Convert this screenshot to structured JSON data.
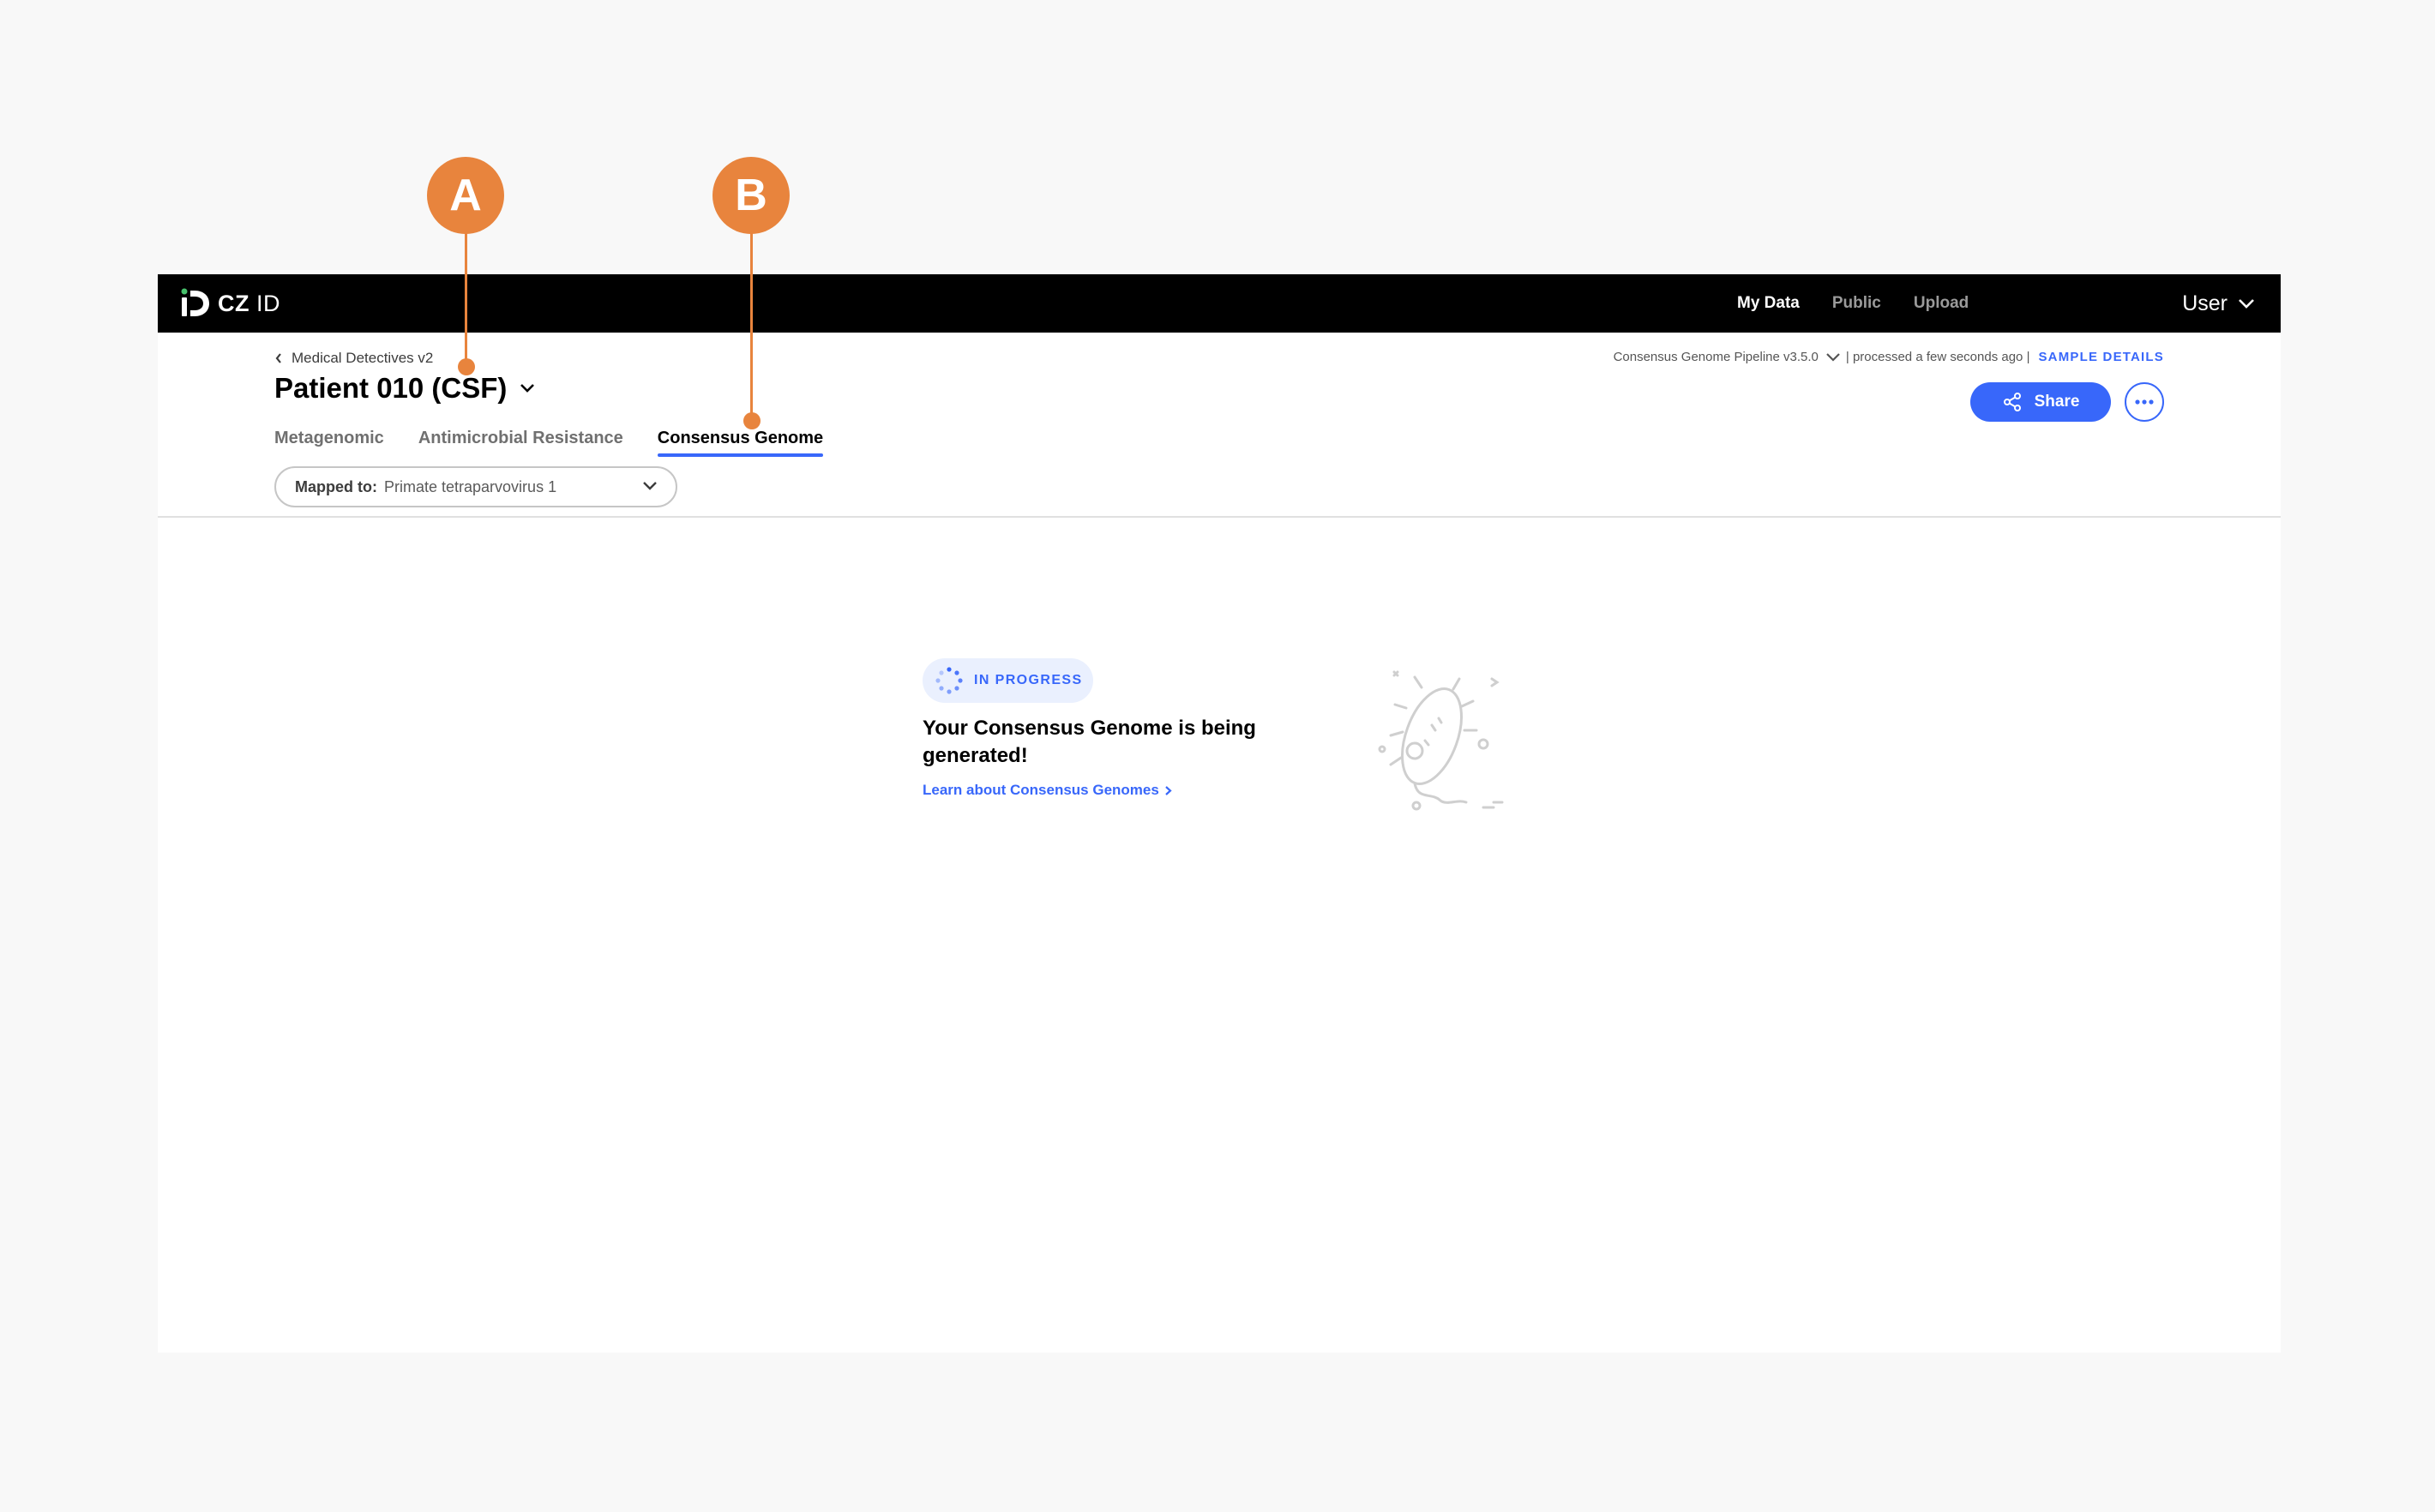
{
  "topbar": {
    "logo": {
      "mark": "iD",
      "text_bold": "CZ",
      "text_light": "ID"
    },
    "nav": [
      {
        "label": "My Data",
        "active": true
      },
      {
        "label": "Public",
        "active": false
      },
      {
        "label": "Upload",
        "active": false
      }
    ],
    "user_label": "User"
  },
  "header": {
    "breadcrumb": "Medical Detectives v2",
    "title": "Patient 010 (CSF)",
    "pipeline_version": "Consensus Genome Pipeline v3.5.0",
    "processed_text": "| processed a few seconds ago |",
    "sample_details": "SAMPLE DETAILS",
    "share_label": "Share"
  },
  "tabs": [
    {
      "label": "Metagenomic",
      "active": false
    },
    {
      "label": "Antimicrobial Resistance",
      "active": false
    },
    {
      "label": "Consensus Genome",
      "active": true
    }
  ],
  "mapped_to": {
    "label": "Mapped to:",
    "value": "Primate tetraparvovirus 1"
  },
  "status": {
    "badge": "IN PROGRESS",
    "title": "Your Consensus Genome is being generated!",
    "link": "Learn about Consensus Genomes"
  },
  "callouts": [
    {
      "label": "A"
    },
    {
      "label": "B"
    }
  ],
  "colors": {
    "accent": "#3867fa",
    "callout": "#e8843d",
    "topbar": "#000000"
  }
}
